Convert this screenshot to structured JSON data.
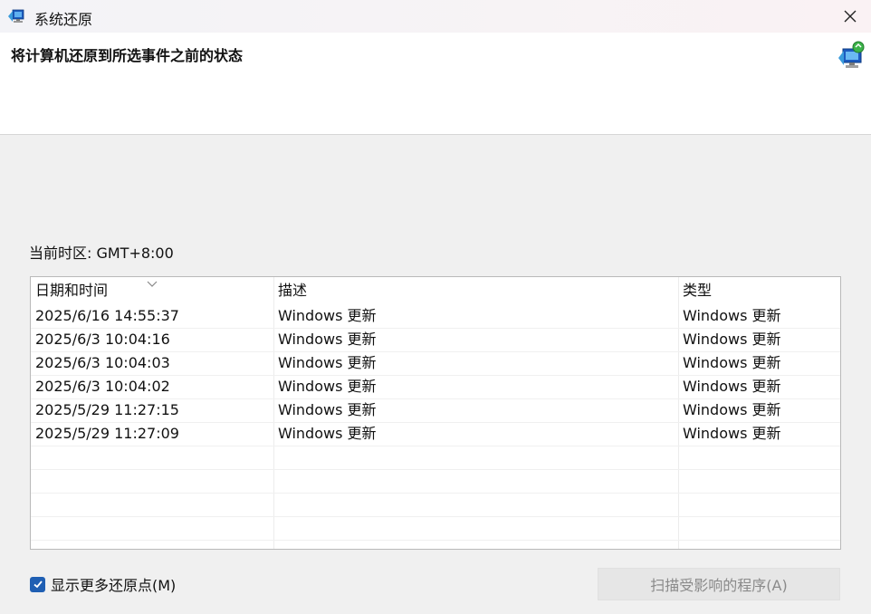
{
  "window": {
    "title": "系统还原",
    "close_icon": "close-icon",
    "app_icon": "system-restore-icon"
  },
  "header": {
    "title": "将计算机还原到所选事件之前的状态",
    "icon": "system-restore-icon"
  },
  "timezone": "当前时区: GMT+8:00",
  "table": {
    "columns": [
      "日期和时间",
      "描述",
      "类型"
    ],
    "sort_icon": "chevron-down-icon",
    "rows": [
      [
        "2025/6/16 14:55:37",
        "Windows 更新",
        "Windows 更新"
      ],
      [
        "2025/6/3 10:04:16",
        "Windows 更新",
        "Windows 更新"
      ],
      [
        "2025/6/3 10:04:03",
        "Windows 更新",
        "Windows 更新"
      ],
      [
        "2025/6/3 10:04:02",
        "Windows 更新",
        "Windows 更新"
      ],
      [
        "2025/5/29 11:27:15",
        "Windows 更新",
        "Windows 更新"
      ],
      [
        "2025/5/29 11:27:09",
        "Windows 更新",
        "Windows 更新"
      ]
    ]
  },
  "show_more": {
    "label": "显示更多还原点(M)",
    "checked": true
  },
  "scan_button": {
    "label": "扫描受影响的程序(A)",
    "enabled": false
  },
  "colors": {
    "accent": "#1f5fb3",
    "disabled_text": "#8a8a8a"
  }
}
